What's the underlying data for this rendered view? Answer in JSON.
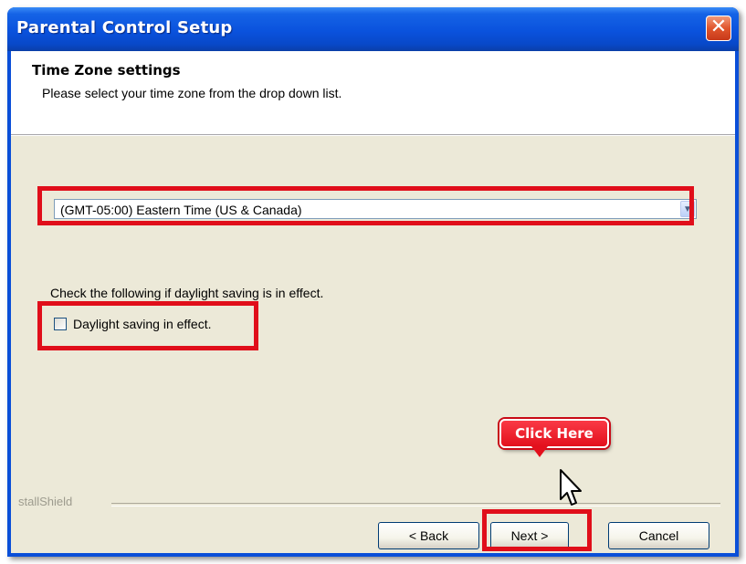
{
  "window": {
    "title": "Parental Control Setup",
    "close_glyph": "✕"
  },
  "header": {
    "title": "Time Zone settings",
    "subtitle": "Please select your time zone from the drop down list."
  },
  "timezone": {
    "selected": "(GMT-05:00) Eastern Time (US & Canada)",
    "arrow_icon": "chevron-down-icon"
  },
  "daylight": {
    "instruction": "Check the following if daylight saving is in effect.",
    "checkbox_label": "Daylight saving in effect.",
    "checked": false
  },
  "footer": {
    "brand": "stallShield"
  },
  "buttons": {
    "back": "< Back",
    "next": "Next >",
    "cancel": "Cancel"
  },
  "annotation": {
    "callout": "Click Here"
  },
  "colors": {
    "titlebar": "#0a52dd",
    "highlight": "#e00e1a",
    "dialog_bg": "#ece9d8"
  }
}
